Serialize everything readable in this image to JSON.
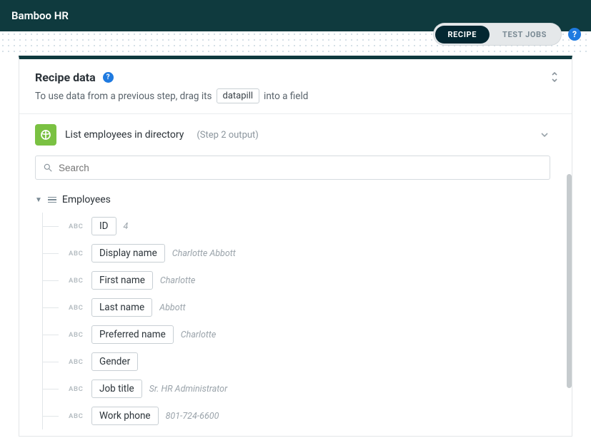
{
  "header": {
    "app_title": "Bamboo HR"
  },
  "tabs": {
    "recipe": "RECIPE",
    "test_jobs": "TEST JOBS"
  },
  "help": {
    "glyph": "?"
  },
  "panel": {
    "title": "Recipe data",
    "subtitle_pre": "To use data from a previous step, drag its",
    "subtitle_chip": "datapill",
    "subtitle_post": "into a field"
  },
  "step": {
    "label": "List employees in directory",
    "output": "(Step 2 output)"
  },
  "search": {
    "placeholder": "Search"
  },
  "tree": {
    "root_label": "Employees",
    "fields": [
      {
        "type": "ABC",
        "name": "ID",
        "sample": "4"
      },
      {
        "type": "ABC",
        "name": "Display name",
        "sample": "Charlotte Abbott"
      },
      {
        "type": "ABC",
        "name": "First name",
        "sample": "Charlotte"
      },
      {
        "type": "ABC",
        "name": "Last name",
        "sample": "Abbott"
      },
      {
        "type": "ABC",
        "name": "Preferred name",
        "sample": "Charlotte"
      },
      {
        "type": "ABC",
        "name": "Gender",
        "sample": ""
      },
      {
        "type": "ABC",
        "name": "Job title",
        "sample": "Sr. HR Administrator"
      },
      {
        "type": "ABC",
        "name": "Work phone",
        "sample": "801-724-6600"
      }
    ]
  }
}
